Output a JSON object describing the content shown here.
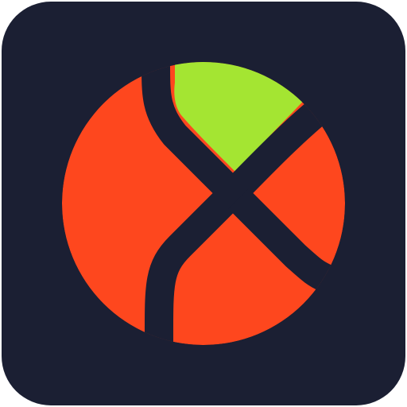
{
  "icon": {
    "name": "app-icon-x-orb",
    "colors": {
      "background": "#1b1f33",
      "primary_orange": "#fe471e",
      "accent_lime": "#a4e532",
      "separator": "#1b1f33"
    }
  }
}
